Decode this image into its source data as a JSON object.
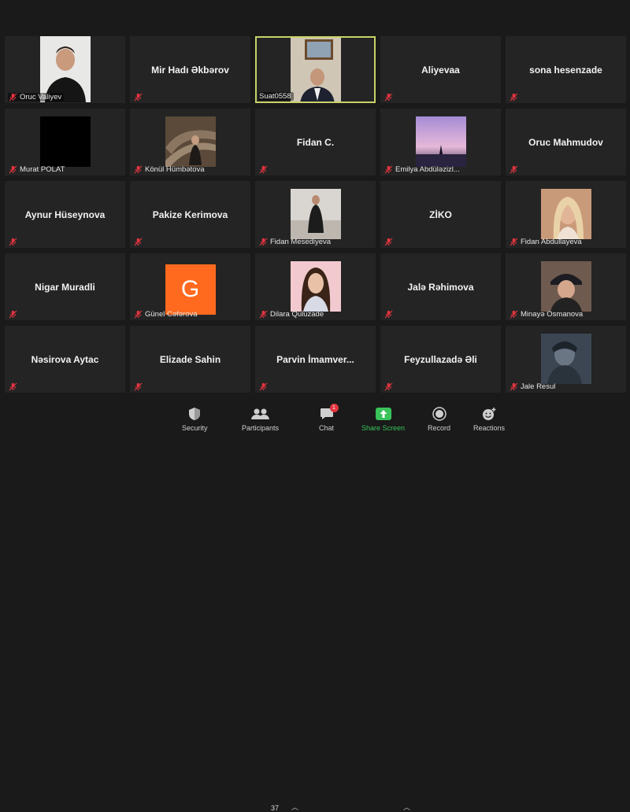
{
  "participants": [
    {
      "name": "Oruc Valiyev",
      "video": true
    },
    {
      "name": "Mir Hadı Əkbərov",
      "video": false
    },
    {
      "name": "Suat0558",
      "video": true,
      "active": true
    },
    {
      "name": "Aliyevaa",
      "video": false
    },
    {
      "name": "sona hesenzade",
      "video": false
    },
    {
      "name": "Murat POLAT",
      "video": true
    },
    {
      "name": "Könül Hümbətova",
      "video": true
    },
    {
      "name": "Fidan C.",
      "video": false
    },
    {
      "name": "Emilya Abdüləzizl...",
      "video": true
    },
    {
      "name": "Oruc Mahmudov",
      "video": false
    },
    {
      "name": "Aynur Hüseynova",
      "video": false
    },
    {
      "name": "Pakize Kerimova",
      "video": false
    },
    {
      "name": "Fidan Mesediyeva",
      "video": true
    },
    {
      "name": "ZİKO",
      "video": false
    },
    {
      "name": "Fidan Abdullayeva",
      "video": true
    },
    {
      "name": "Nigar Muradli",
      "video": false
    },
    {
      "name": "Günel Cəfərova",
      "video": true,
      "avatar_letter": "G"
    },
    {
      "name": "Dilara Quluzade",
      "video": true
    },
    {
      "name": "Jalə Rəhimova",
      "video": false
    },
    {
      "name": "Minayə Osmanova",
      "video": true
    },
    {
      "name": "Nəsirova Aytac",
      "video": false
    },
    {
      "name": "Elizade Sahin",
      "video": false
    },
    {
      "name": "Parvin İmamver...",
      "video": false
    },
    {
      "name": "Feyzullazadə Əli",
      "video": false
    },
    {
      "name": "Jale Resul",
      "video": true
    }
  ],
  "toolbar": {
    "security": "Security",
    "participants": "Participants",
    "participant_count": "37",
    "chat": "Chat",
    "chat_badge": "1",
    "share_screen": "Share Screen",
    "record": "Record",
    "reactions": "Reactions"
  },
  "colors": {
    "active_border": "#c8d26a",
    "muted_icon": "#e2343f",
    "share_green": "#39c35a",
    "avatar_orange": "#ff6a1f"
  }
}
